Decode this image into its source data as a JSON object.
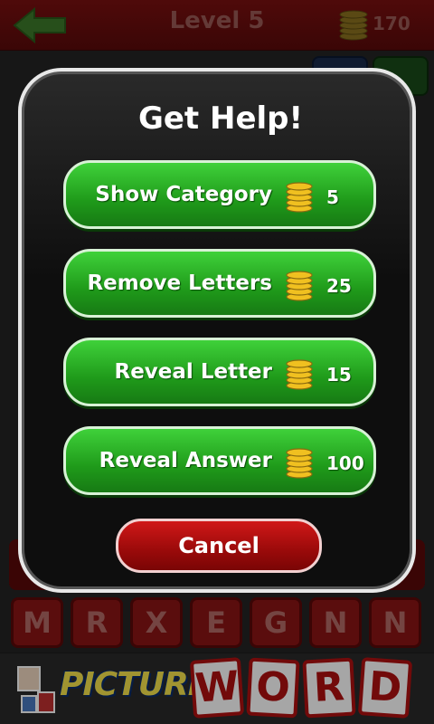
{
  "header": {
    "level_title": "Level 5",
    "coin_count": "170"
  },
  "dialog": {
    "title": "Get Help!",
    "options": [
      {
        "label": "Show Category",
        "cost": "5"
      },
      {
        "label": "Remove Letters",
        "cost": "25"
      },
      {
        "label": "Reveal Letter",
        "cost": "15"
      },
      {
        "label": "Reveal Answer",
        "cost": "100"
      }
    ],
    "cancel_label": "Cancel"
  },
  "letter_tiles": [
    "M",
    "R",
    "X",
    "E",
    "G",
    "N",
    "N"
  ],
  "logo": {
    "picture": "PICTURE",
    "word": [
      "W",
      "O",
      "R",
      "D"
    ]
  },
  "colors": {
    "accent_green": "#2fb82a",
    "accent_red": "#c01010",
    "coin_gold": "#f0c020"
  }
}
